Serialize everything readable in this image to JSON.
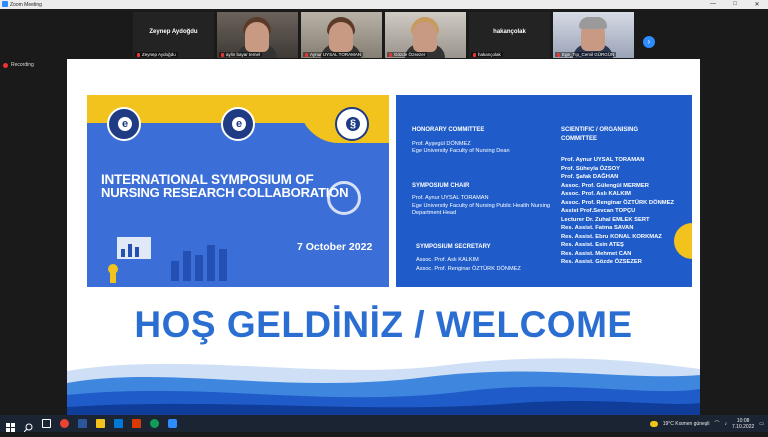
{
  "window": {
    "title": "Zoom Meeting",
    "controls": [
      "—",
      "□",
      "✕"
    ]
  },
  "participants": [
    {
      "name": "Zeynep Aydoğdu",
      "label": "Zeynep Aydoğdu",
      "video": false
    },
    {
      "name": "",
      "label": "aylin bayar temel",
      "video": true
    },
    {
      "name": "",
      "label": "Aynur UYSAL TORAMAN",
      "video": true
    },
    {
      "name": "",
      "label": "Gözde Özsezer",
      "video": true
    },
    {
      "name": "hakançolak",
      "label": "hakançolak",
      "video": false
    },
    {
      "name": "",
      "label": "Ege_Tıp_Cemil GÜRGÜN",
      "video": true
    }
  ],
  "recording": {
    "label": "Recording"
  },
  "slide": {
    "symposium_title_line1": "INTERNATIONAL SYMPOSIUM OF",
    "symposium_title_line2": "NURSING RESEARCH COLLABORATION",
    "date": "7 October 2022",
    "honorary": {
      "heading": "HONORARY COMMITTEE",
      "name": "Prof. Ayşegül DÖNMEZ",
      "role": "Ege University Faculty of Nursing Dean"
    },
    "chair": {
      "heading": "SYMPOSIUM CHAIR",
      "name": "Prof. Aynur UYSAL TORAMAN",
      "role": "Ege University Faculty of Nursing Public Health Nursing Department Head"
    },
    "secretary": {
      "heading": "SYMPOSIUM SECRETARY",
      "members": [
        "Assoc. Prof. Aslı KALKIM",
        "Assoc. Prof. Renginar ÖZTÜRK DÖNMEZ"
      ]
    },
    "scientific": {
      "heading_line1": "SCIENTIFIC / ORGANISING",
      "heading_line2": "COMMITTEE",
      "members": [
        "Prof. Aynur UYSAL TORAMAN",
        "Prof. Süheyla ÖZSOY",
        "Prof. Şafak DAĞHAN",
        "Assoc. Prof. Gülengül MERMER",
        "Assoc. Prof. Aslı KALKIM",
        "Assoc. Prof. Renginar ÖZTÜRK DÖNMEZ",
        "Assist Prof.Sevcan TOPÇU",
        "Lecturer Dr. Zuhal EMLEK SERT",
        "Res. Assist. Fatma SAVAN",
        "Res. Assist. Ebru KONAL KORKMAZ",
        "Res. Assist. Esin ATEŞ",
        "Res. Assist. Mehmet CAN",
        "Res. Assist. Gözde ÖZSEZER"
      ]
    },
    "welcome": "HOŞ GELDİNİZ / WELCOME"
  },
  "taskbar": {
    "weather": "19°C  Kısmen güneşli",
    "time": "10:08",
    "date": "7.10.2022"
  },
  "colors": {
    "accent": "#2d8cff",
    "slide_blue": "#1f5cc9",
    "slide_yellow": "#f2c31c",
    "welcome_blue": "#2b6ed2"
  }
}
